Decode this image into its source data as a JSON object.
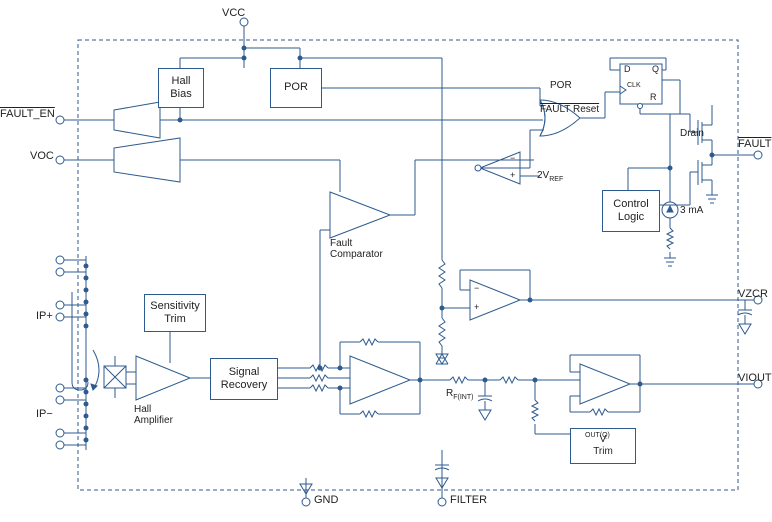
{
  "pins": {
    "vcc": "VCC",
    "fault_en_bar": "FAULT_EN",
    "voc": "VOC",
    "ip_plus": "IP+",
    "ip_minus": "IP−",
    "fault_bar": "FAULT",
    "vzcr": "VZCR",
    "viout": "VIOUT",
    "gnd": "GND",
    "filter": "FILTER"
  },
  "blocks": {
    "hall_bias": "Hall\nBias",
    "por": "POR",
    "fault_reset_bar": "FAULT Reset",
    "por_label": "POR",
    "control_logic": "Control\nLogic",
    "drain": "Drain",
    "fault_comparator": "Fault\nComparator",
    "sensitivity_trim": "Sensitivity\nTrim",
    "signal_recovery": "Signal\nRecovery",
    "hall_amplifier": "Hall\nAmplifier",
    "vout_q_trim": "V\nTrim",
    "vout_q_sub": "OUT(Q)"
  },
  "values": {
    "two_vref": "2V",
    "vref_sub": "REF",
    "current_source": "3 mA",
    "rf_int": "R",
    "rf_int_sub": "F(INT)"
  },
  "flipflop": {
    "d": "D",
    "q": "Q",
    "clk": "CLK",
    "r": "R"
  },
  "opamp": {
    "plus": "+",
    "minus": "−"
  }
}
